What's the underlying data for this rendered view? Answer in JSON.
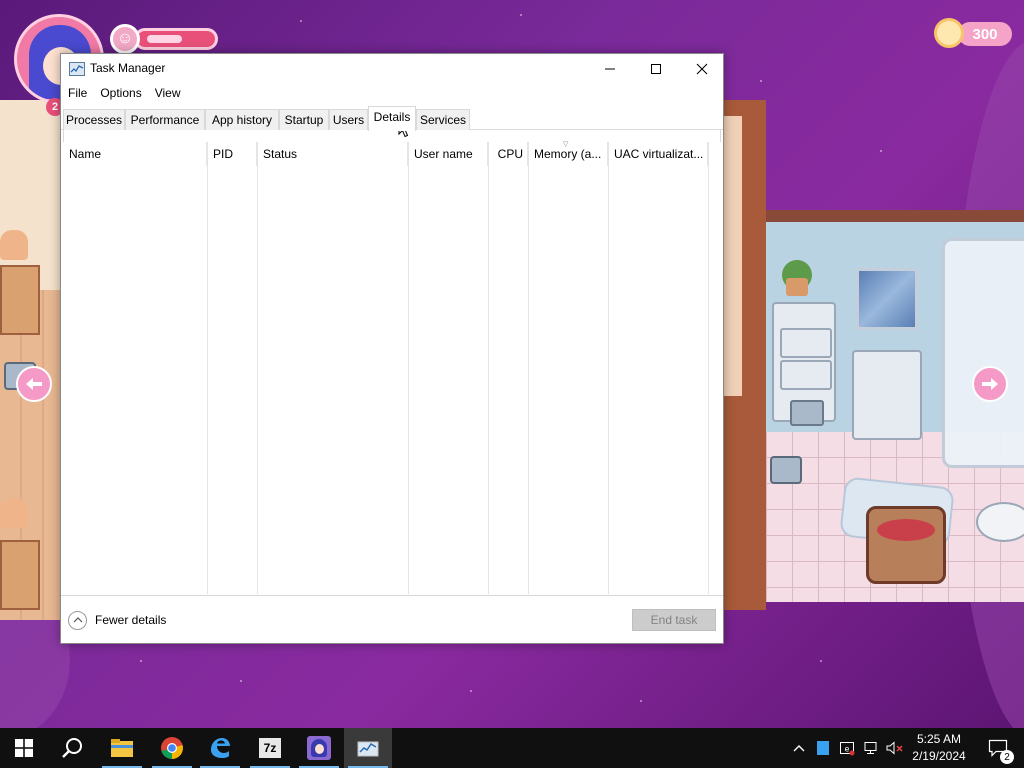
{
  "window": {
    "title": "Task Manager",
    "menu": [
      "File",
      "Options",
      "View"
    ],
    "tabs": [
      "Processes",
      "Performance",
      "App history",
      "Startup",
      "Users",
      "Details",
      "Services"
    ],
    "active_tab": "Details",
    "columns": [
      "Name",
      "PID",
      "Status",
      "User name",
      "CPU",
      "Memory (a...",
      "UAC virtualizat..."
    ],
    "footer": {
      "fewer_details": "Fewer details",
      "end_task": "End task"
    }
  },
  "game_hud": {
    "coins": "300",
    "level": "2",
    "mood_fraction": 0.6
  },
  "taskbar": {
    "time": "5:25 AM",
    "date": "2/19/2024",
    "notification_count": "2",
    "pinned": [
      "start-icon",
      "search-icon",
      "file-explorer-icon",
      "chrome-icon",
      "edge-icon",
      "7zip-icon",
      "game-icon",
      "task-manager-icon"
    ],
    "sevenzip_label": "7z"
  },
  "colors": {
    "background": "#7a2a9a",
    "taskbar": "#101010",
    "accent_pink": "#f59ac6"
  }
}
